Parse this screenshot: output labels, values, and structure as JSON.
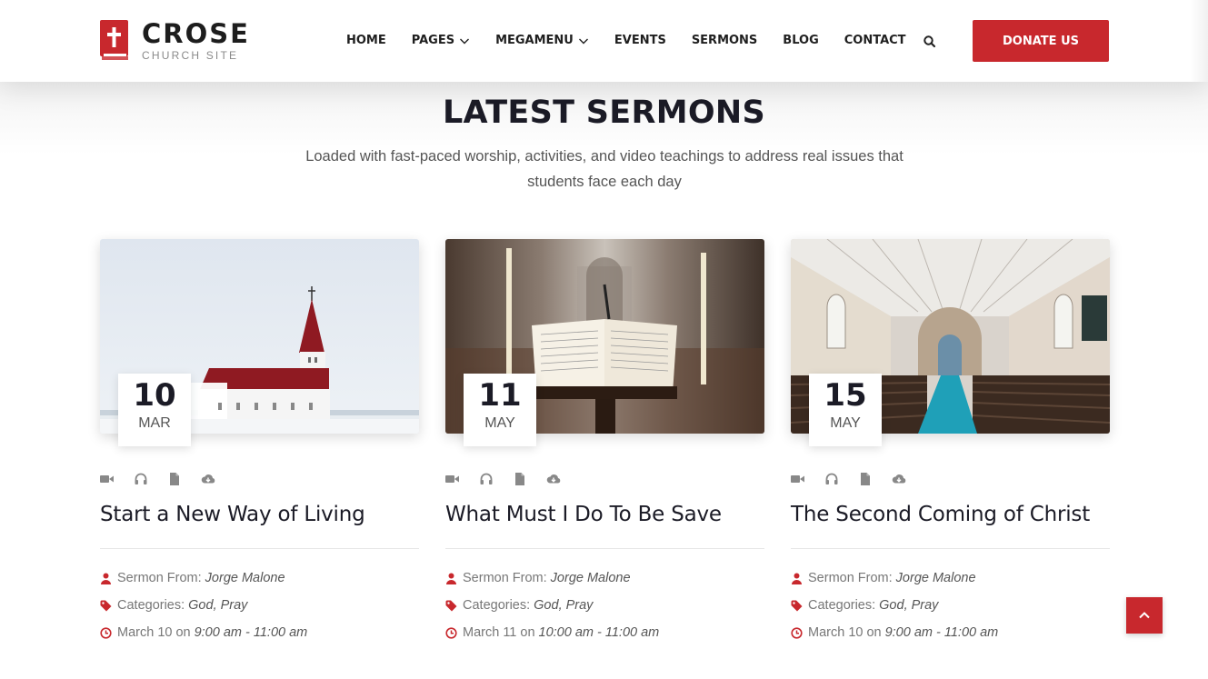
{
  "brand": {
    "name": "CROSE",
    "tagline": "CHURCH SITE",
    "accent": "#c8282d"
  },
  "nav": {
    "items": [
      {
        "label": "HOME",
        "dropdown": false
      },
      {
        "label": "PAGES",
        "dropdown": true
      },
      {
        "label": "MEGAMENU",
        "dropdown": true
      },
      {
        "label": "EVENTS",
        "dropdown": false
      },
      {
        "label": "SERMONS",
        "dropdown": false
      },
      {
        "label": "BLOG",
        "dropdown": false
      },
      {
        "label": "CONTACT",
        "dropdown": false
      }
    ],
    "donate_label": "DONATE US"
  },
  "section": {
    "title": "LATEST SERMONS",
    "subtitle": "Loaded with fast-paced worship, activities, and video teachings to address real issues that students face each day"
  },
  "sermons": [
    {
      "day": "10",
      "month": "MAR",
      "title": "Start a New Way of Living",
      "from_label": "Sermon From:",
      "speaker": "Jorge Malone",
      "cat_label": "Categories:",
      "categories": "God, Pray",
      "date_text": "March 10",
      "on_text": "on",
      "time": "9:00 am - 11:00 am",
      "image": "church-snow-photo"
    },
    {
      "day": "11",
      "month": "MAY",
      "title": "What Must I Do To Be Save",
      "from_label": "Sermon From:",
      "speaker": "Jorge Malone",
      "cat_label": "Categories:",
      "categories": "God, Pray",
      "date_text": "March 11",
      "on_text": "on",
      "time": "10:00 am - 11:00 am",
      "image": "bible-lectern-photo"
    },
    {
      "day": "15",
      "month": "MAY",
      "title": "The Second Coming of Christ",
      "from_label": "Sermon From:",
      "speaker": "Jorge Malone",
      "cat_label": "Categories:",
      "categories": "God, Pray",
      "date_text": "March 10",
      "on_text": "on",
      "time": "9:00 am - 11:00 am",
      "image": "church-interior-photo"
    }
  ],
  "icons": {
    "media": [
      "video-icon",
      "headphones-icon",
      "document-icon",
      "cloud-download-icon"
    ],
    "meta": [
      "user-icon",
      "tag-icon",
      "clock-icon"
    ],
    "search": "search-icon",
    "back_to_top": "chevron-up-icon"
  }
}
